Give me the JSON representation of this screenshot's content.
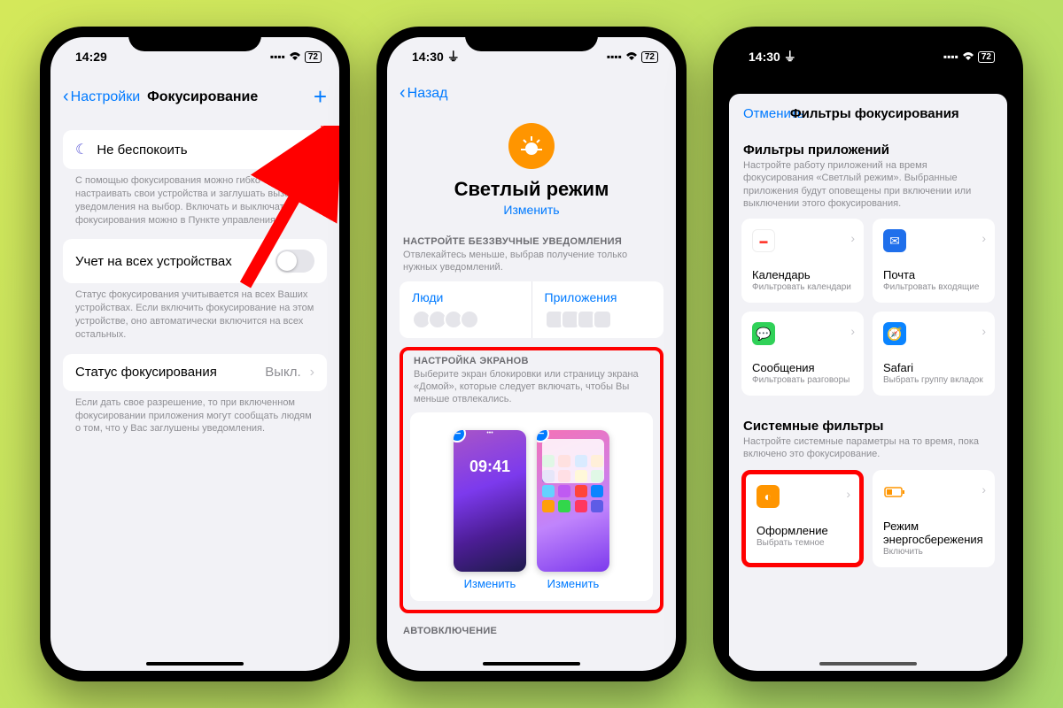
{
  "status": {
    "time1": "14:29",
    "time2": "14:30",
    "time3": "14:30",
    "battery": "72"
  },
  "screen1": {
    "back": "Настройки",
    "title": "Фокусирование",
    "dnd": "Не беспокоить",
    "desc1": "С помощью фокусирования можно гибко настраивать свои устройства и заглушать вызовы и уведомления на выбор. Включать и выключать фокусирования можно в Пункте управления.",
    "shareAll": "Учет на всех устройствах",
    "desc2": "Статус фокусирования учитывается на всех Ваших устройствах. Если включить фокусирование на этом устройстве, оно автоматически включится на всех остальных.",
    "focusStatus": "Статус фокусирования",
    "focusStatusValue": "Выкл.",
    "desc3": "Если дать свое разрешение, то при включенном фокусировании приложения могут сообщать людям о том, что у Вас заглушены уведомления."
  },
  "screen2": {
    "back": "Назад",
    "modeTitle": "Светлый режим",
    "change": "Изменить",
    "notifHead": "НАСТРОЙТЕ БЕЗЗВУЧНЫЕ УВЕДОМЛЕНИЯ",
    "notifDesc": "Отвлекайтесь меньше, выбрав получение только нужных уведомлений.",
    "people": "Люди",
    "apps": "Приложения",
    "screensHead": "НАСТРОЙКА ЭКРАНОВ",
    "screensDesc": "Выберите экран блокировки или страницу экрана «Домой», которые следует включать, чтобы Вы меньше отвлекались.",
    "thumbTime": "09:41",
    "thumbChange": "Изменить",
    "autoHead": "АВТОВКЛЮЧЕНИЕ"
  },
  "screen3": {
    "cancel": "Отменить",
    "title": "Фильтры фокусирования",
    "appFiltersTitle": "Фильтры приложений",
    "appFiltersDesc": "Настройте работу приложений на время фокусирования «Светлый режим». Выбранные приложения будут оповещены при включении или выключении этого фокусирования.",
    "tiles": {
      "calendar": {
        "title": "Календарь",
        "sub": "Фильтровать календари"
      },
      "mail": {
        "title": "Почта",
        "sub": "Фильтровать входящие"
      },
      "messages": {
        "title": "Сообщения",
        "sub": "Фильтровать разговоры"
      },
      "safari": {
        "title": "Safari",
        "sub": "Выбрать группу вкладок"
      }
    },
    "sysFiltersTitle": "Системные фильтры",
    "sysFiltersDesc": "Настройте системные параметры на то время, пока включено это фокусирование.",
    "sysTiles": {
      "appearance": {
        "title": "Оформление",
        "sub": "Выбрать темное"
      },
      "lowpower": {
        "title": "Режим энергосбережения",
        "sub": "Включить"
      }
    }
  }
}
